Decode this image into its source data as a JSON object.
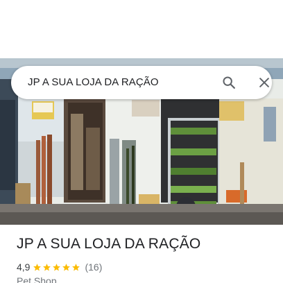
{
  "search": {
    "query": "JP A SUA LOJA DA RAÇÃO",
    "search_icon": "search-icon",
    "close_icon": "close-icon"
  },
  "place": {
    "title": "JP A SUA LOJA DA RAÇÃO",
    "rating": "4,9",
    "stars": 5,
    "review_count": "(16)",
    "category": "Pet Shop"
  },
  "colors": {
    "star": "#fbbc04",
    "text_primary": "#202124",
    "text_secondary": "#70757a",
    "icon": "#5f6368"
  }
}
